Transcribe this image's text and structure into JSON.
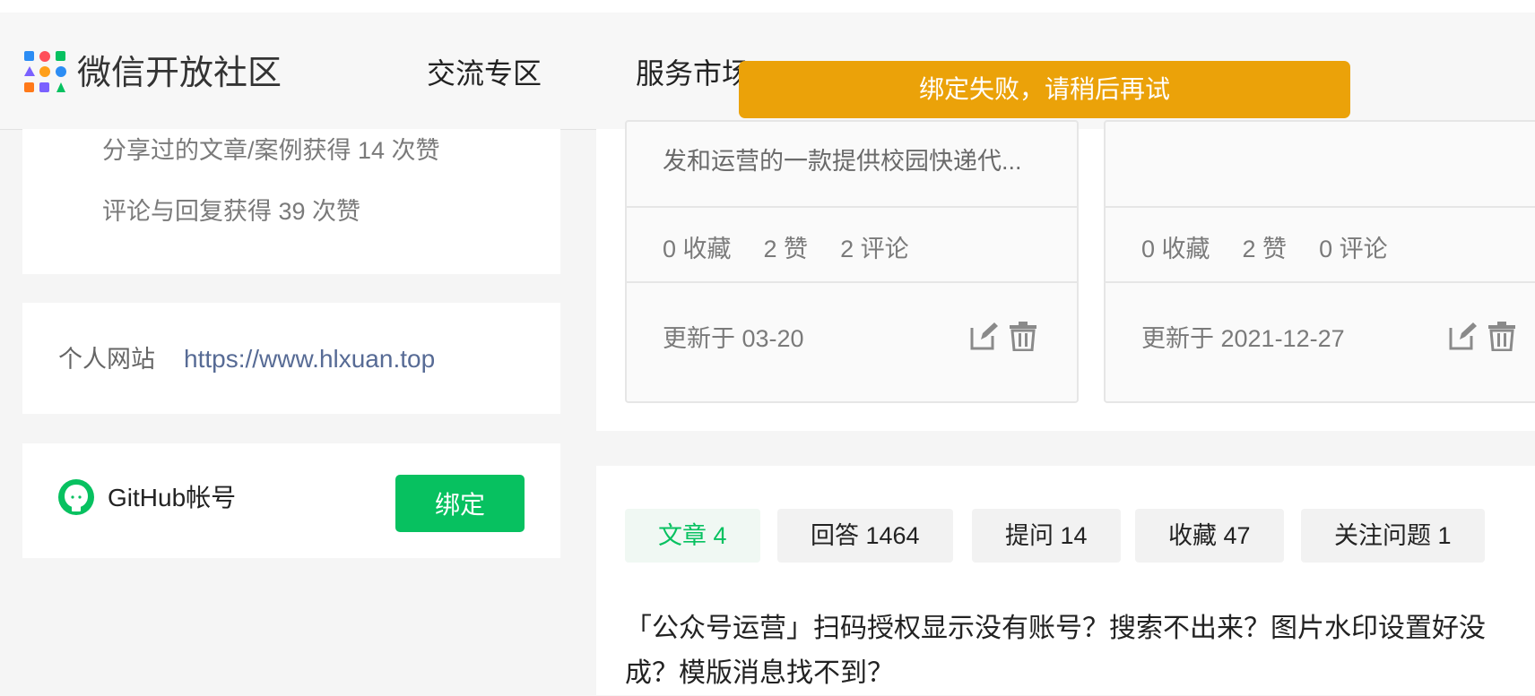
{
  "header": {
    "brand": "微信开放社区",
    "nav": [
      "交流专区",
      "服务市场"
    ],
    "toast": "绑定失败，请稍后再试"
  },
  "profile": {
    "likes_shared": "分享过的文章/案例获得 14 次赞",
    "likes_comments": "评论与回复获得 39 次赞",
    "site_label": "个人网站",
    "site_url": "https://www.hlxuan.top",
    "github_label": "GitHub帐号",
    "bind_button": "绑定"
  },
  "projects": [
    {
      "desc": "发和运营的一款提供校园快递代...",
      "favorites": "0 收藏",
      "likes": "2 赞",
      "comments": "2 评论",
      "updated": "更新于 03-20"
    },
    {
      "desc": "",
      "favorites": "0 收藏",
      "likes": "2 赞",
      "comments": "0 评论",
      "updated": "更新于 2021-12-27"
    }
  ],
  "tabs": [
    "文章 4",
    "回答 1464",
    "提问 14",
    "收藏 47",
    "关注问题 1"
  ],
  "active_tab": "文章 4",
  "article": {
    "title": "「公众号运营」扫码授权显示没有账号？搜索不出来？图片水印设置好没成？模版消息找不到？"
  },
  "icons": {
    "logo": "wechat-open-community-logo",
    "github": "github-icon",
    "edit": "edit-icon",
    "delete": "trash-icon"
  },
  "colors": {
    "accent": "#07c160",
    "toast": "#eba209",
    "link": "#576b95"
  }
}
